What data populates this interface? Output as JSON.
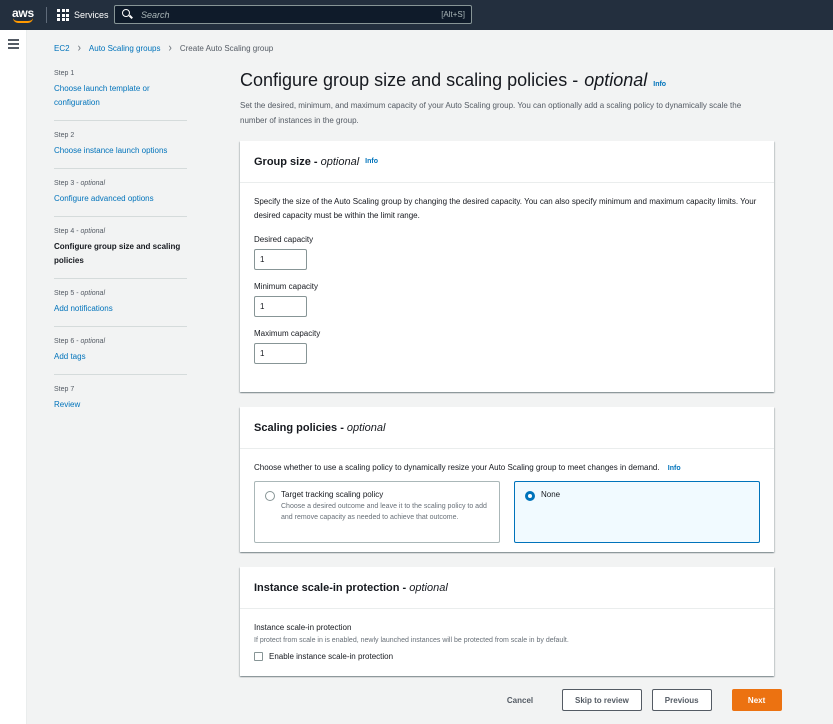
{
  "topnav": {
    "logo_text": "aws",
    "services_label": "Services",
    "search_placeholder": "Search",
    "search_shortcut": "[Alt+S]"
  },
  "breadcrumb": [
    {
      "label": "EC2"
    },
    {
      "label": "Auto Scaling groups"
    },
    {
      "label": "Create Auto Scaling group"
    }
  ],
  "steps": [
    {
      "num": "Step 1",
      "label": "Choose launch template or configuration"
    },
    {
      "num": "Step 2",
      "label": "Choose instance launch options"
    },
    {
      "num": "Step 3",
      "optional": "optional",
      "label": "Configure advanced options"
    },
    {
      "num": "Step 4",
      "optional": "optional",
      "label": "Configure group size and scaling policies"
    },
    {
      "num": "Step 5",
      "optional": "optional",
      "label": "Add notifications"
    },
    {
      "num": "Step 6",
      "optional": "optional",
      "label": "Add tags"
    },
    {
      "num": "Step 7",
      "label": "Review"
    }
  ],
  "page": {
    "title": "Configure group size and scaling policies -",
    "title_optional": "optional",
    "info": "Info",
    "description": "Set the desired, minimum, and maximum capacity of your Auto Scaling group. You can optionally add a scaling policy to dynamically scale the number of instances in the group."
  },
  "group_size": {
    "title": "Group size -",
    "title_optional": "optional",
    "info": "Info",
    "description": "Specify the size of the Auto Scaling group by changing the desired capacity. You can also specify minimum and maximum capacity limits. Your desired capacity must be within the limit range.",
    "desired_label": "Desired capacity",
    "desired_value": "1",
    "min_label": "Minimum capacity",
    "min_value": "1",
    "max_label": "Maximum capacity",
    "max_value": "1"
  },
  "scaling_policies": {
    "title": "Scaling policies -",
    "title_optional": "optional",
    "description": "Choose whether to use a scaling policy to dynamically resize your Auto Scaling group to meet changes in demand.",
    "info": "Info",
    "option_target_label": "Target tracking scaling policy",
    "option_target_desc": "Choose a desired outcome and leave it to the scaling policy to add and remove capacity as needed to achieve that outcome.",
    "option_none_label": "None",
    "selected": "None"
  },
  "scale_in": {
    "title": "Instance scale-in protection -",
    "title_optional": "optional",
    "label": "Instance scale-in protection",
    "description": "If protect from scale in is enabled, newly launched instances will be protected from scale in by default.",
    "checkbox_label": "Enable instance scale-in protection",
    "checked": false
  },
  "footer": {
    "cancel": "Cancel",
    "skip": "Skip to review",
    "previous": "Previous",
    "next": "Next"
  },
  "colors": {
    "nav_bg": "#232f3e",
    "link": "#0073bb",
    "primary": "#ec7211"
  }
}
